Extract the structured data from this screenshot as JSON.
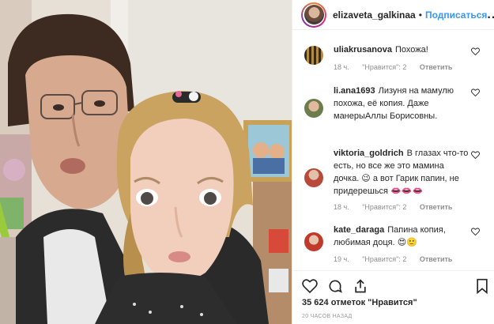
{
  "header": {
    "username": "elizaveta_galkinaa",
    "separator": "•",
    "follow_label": "Подписаться",
    "more_label": "..."
  },
  "comments": [
    {
      "username": "uliakrusanova",
      "text": "Похожа!",
      "time": "18 ч.",
      "likes": "\"Нравится\": 2",
      "reply": "Ответить"
    },
    {
      "username": "li.ana1693",
      "text": "Лизуня на мамулю похожа, её копия. Даже манерыАллы Борисовны.",
      "time": "",
      "likes": "",
      "reply": ""
    },
    {
      "username": "viktoria_goldrich",
      "text": "В глазах что-то есть, но все же это мамина дочка. 😉 а вот Гарик папин, не придерешься 👄👄👄",
      "time": "18 ч.",
      "likes": "\"Нравится\": 2",
      "reply": "Ответить"
    },
    {
      "username": "kate_daraga",
      "text": "Папина копия, любимая доця. 😍🙂",
      "time": "19 ч.",
      "likes": "\"Нравится\": 2",
      "reply": "Ответить"
    }
  ],
  "post": {
    "likes_count": "35 624 отметок \"Нравится\"",
    "timestamp": "20 ЧАСОВ НАЗАД"
  },
  "icons": [
    "heart-icon",
    "comment-icon",
    "share-icon",
    "bookmark-icon"
  ]
}
